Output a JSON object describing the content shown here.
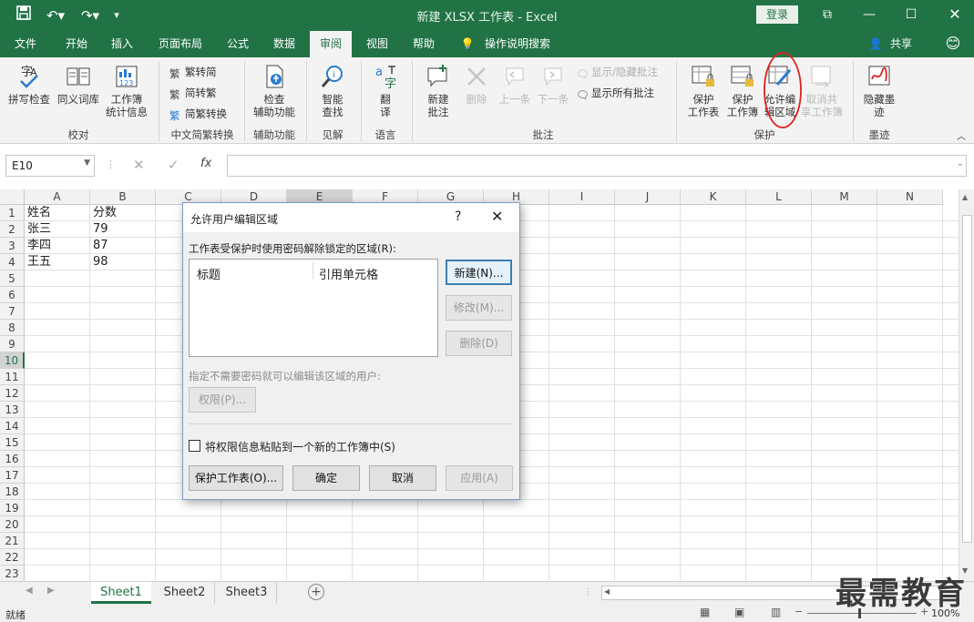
{
  "app": {
    "title": "新建 XLSX 工作表  -  Excel",
    "login": "登录",
    "share": "共享"
  },
  "tabs": [
    "文件",
    "开始",
    "插入",
    "页面布局",
    "公式",
    "数据",
    "审阅",
    "视图",
    "帮助",
    "操作说明搜索"
  ],
  "ribbon": {
    "proofing": {
      "spell": "拼写检查",
      "thesaurus": "同义词库",
      "stats_1": "工作簿",
      "stats_2": "统计信息",
      "label": "校对"
    },
    "chinese": {
      "to_simple": "繁转简",
      "to_trad": "简转繁",
      "convert": "简繁转换",
      "label": "中文简繁转换"
    },
    "access": {
      "check_1": "检查",
      "check_2": "辅助功能",
      "label": "辅助功能"
    },
    "insights": {
      "smart_1": "智能",
      "smart_2": "查找",
      "label": "见解"
    },
    "language": {
      "translate_1": "翻",
      "translate_2": "译",
      "label": "语言"
    },
    "comments": {
      "new_1": "新建",
      "new_2": "批注",
      "delete": "删除",
      "prev": "上一条",
      "next": "下一条",
      "show_hide": "显示/隐藏批注",
      "show_all": "显示所有批注",
      "label": "批注"
    },
    "protect": {
      "sheet_1": "保护",
      "sheet_2": "工作表",
      "wb_1": "保护",
      "wb_2": "工作簿",
      "allow_1": "允许编",
      "allow_2": "辑区域",
      "unshare_1": "取消共",
      "unshare_2": "享工作簿",
      "label": "保护"
    },
    "ink": {
      "hide_1": "隐藏墨",
      "hide_2": "迹",
      "label": "墨迹"
    }
  },
  "formula_bar": {
    "name_box": "E10",
    "fx": "fx",
    "value": ""
  },
  "columns": [
    "A",
    "B",
    "C",
    "D",
    "E",
    "F",
    "G",
    "H",
    "I",
    "J",
    "K",
    "L",
    "M",
    "N"
  ],
  "rows": [
    "1",
    "2",
    "3",
    "4",
    "5",
    "6",
    "7",
    "8",
    "9",
    "10",
    "11",
    "12",
    "13",
    "14",
    "15",
    "16",
    "17",
    "18",
    "19",
    "20",
    "21",
    "22",
    "23"
  ],
  "cells": [
    {
      "a": "姓名",
      "b": "分数"
    },
    {
      "a": "张三",
      "b": "79"
    },
    {
      "a": "李四",
      "b": "87"
    },
    {
      "a": "王五",
      "b": "98"
    }
  ],
  "sheets": [
    "Sheet1",
    "Sheet2",
    "Sheet3"
  ],
  "status": {
    "ready": "就绪",
    "zoom": "100%"
  },
  "dialog": {
    "title": "允许用户编辑区域",
    "help": "?",
    "ranges_label": "工作表受保护时使用密码解除锁定的区域(R):",
    "col_title": "标题",
    "col_ref": "引用单元格",
    "new_btn": "新建(N)...",
    "modify_btn": "修改(M)...",
    "delete_btn": "删除(D)",
    "perm_label": "指定不需要密码就可以编辑该区域的用户:",
    "perm_btn": "权限(P)...",
    "paste_check": "将权限信息粘贴到一个新的工作簿中(S)",
    "protect_btn": "保护工作表(O)...",
    "ok_btn": "确定",
    "cancel_btn": "取消",
    "apply_btn": "应用(A)"
  },
  "watermark": "最需教育",
  "colors": {
    "excel_green": "#217346",
    "highlight_red": "#e02020"
  }
}
